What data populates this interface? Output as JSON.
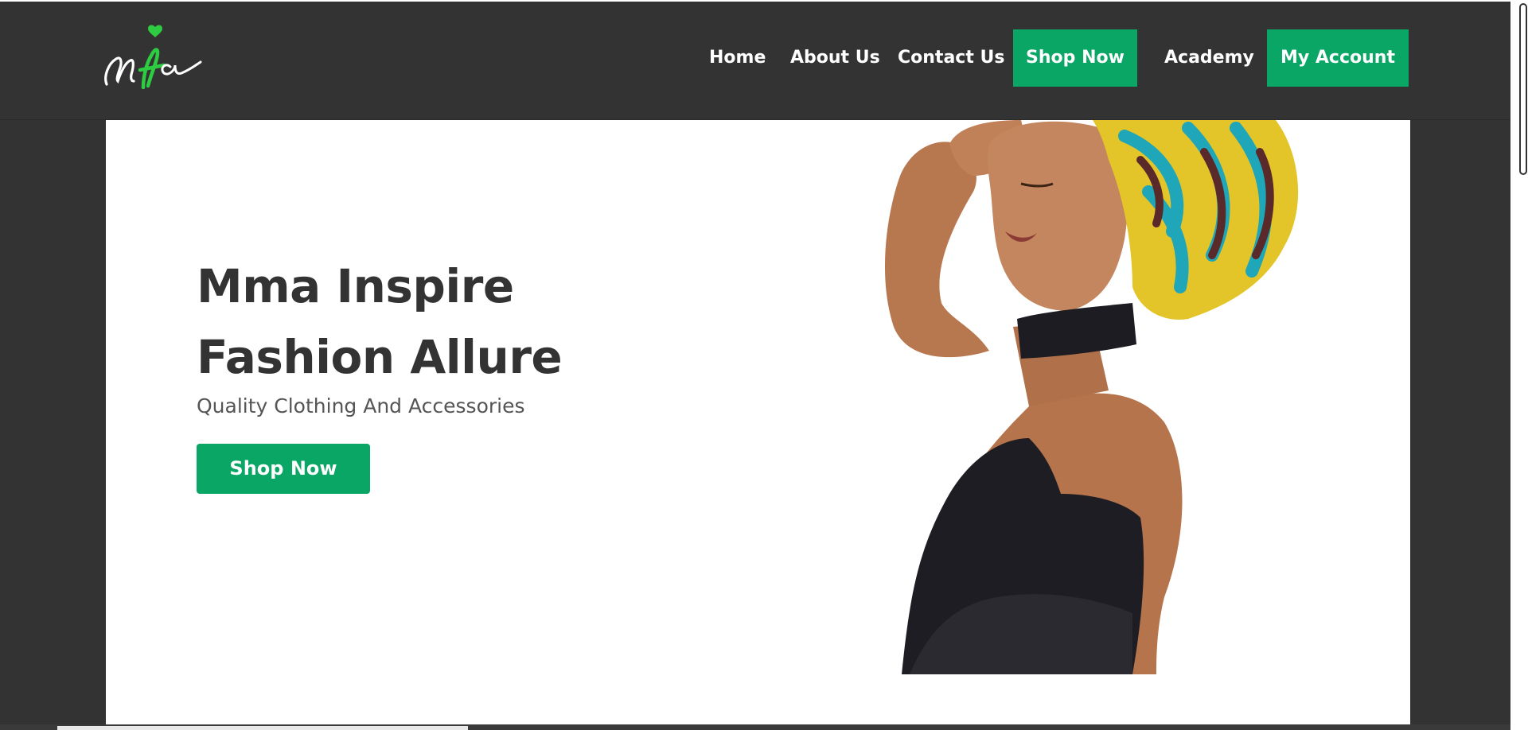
{
  "header": {
    "logo_text": "Mifa",
    "nav": {
      "home": "Home",
      "about": "About Us",
      "contact": "Contact Us",
      "shop": "Shop Now",
      "academy": "Academy",
      "account": "My Account"
    }
  },
  "hero": {
    "title_line1": "Mma Inspire",
    "title_line2": "Fashion Allure",
    "subtitle": "Quality Clothing And Accessories",
    "cta_label": "Shop Now"
  },
  "colors": {
    "accent": "#0aa665",
    "header_bg": "#333333",
    "hero_bg": "#ffffff",
    "text_dark": "#333333",
    "logo_green": "#2ecc40"
  },
  "icons": {
    "logo": "mifa-logo-heart-icon"
  }
}
